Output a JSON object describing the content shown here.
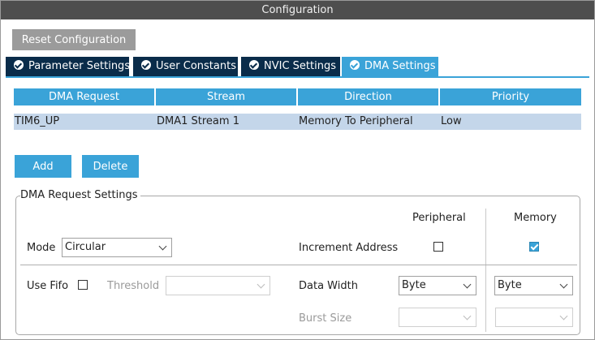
{
  "window": {
    "title": "Configuration"
  },
  "toolbar": {
    "reset_label": "Reset Configuration"
  },
  "tabs": [
    {
      "label": "Parameter Settings",
      "active": false
    },
    {
      "label": "User Constants",
      "active": false
    },
    {
      "label": "NVIC Settings",
      "active": false
    },
    {
      "label": "DMA Settings",
      "active": true
    }
  ],
  "table": {
    "columns": [
      "DMA Request",
      "Stream",
      "Direction",
      "Priority"
    ],
    "rows": [
      [
        "TIM6_UP",
        "DMA1 Stream 1",
        "Memory To Peripheral",
        "Low"
      ]
    ]
  },
  "actions": {
    "add_label": "Add",
    "delete_label": "Delete"
  },
  "settings": {
    "title": "DMA Request Settings",
    "peripheral_header": "Peripheral",
    "memory_header": "Memory",
    "mode": {
      "label": "Mode",
      "value": "Circular"
    },
    "increment_address": {
      "label": "Increment Address",
      "peripheral_checked": false,
      "memory_checked": true
    },
    "use_fifo": {
      "label": "Use Fifo",
      "checked": false
    },
    "threshold": {
      "label": "Threshold",
      "value": ""
    },
    "data_width": {
      "label": "Data Width",
      "peripheral_value": "Byte",
      "memory_value": "Byte"
    },
    "burst_size": {
      "label": "Burst Size",
      "peripheral_value": "",
      "memory_value": ""
    }
  },
  "colors": {
    "accent": "#3aa3d8",
    "tab_dark": "#0a2c4a",
    "title_bar": "#4e4e4e",
    "row_selected": "#c4d6ea"
  }
}
